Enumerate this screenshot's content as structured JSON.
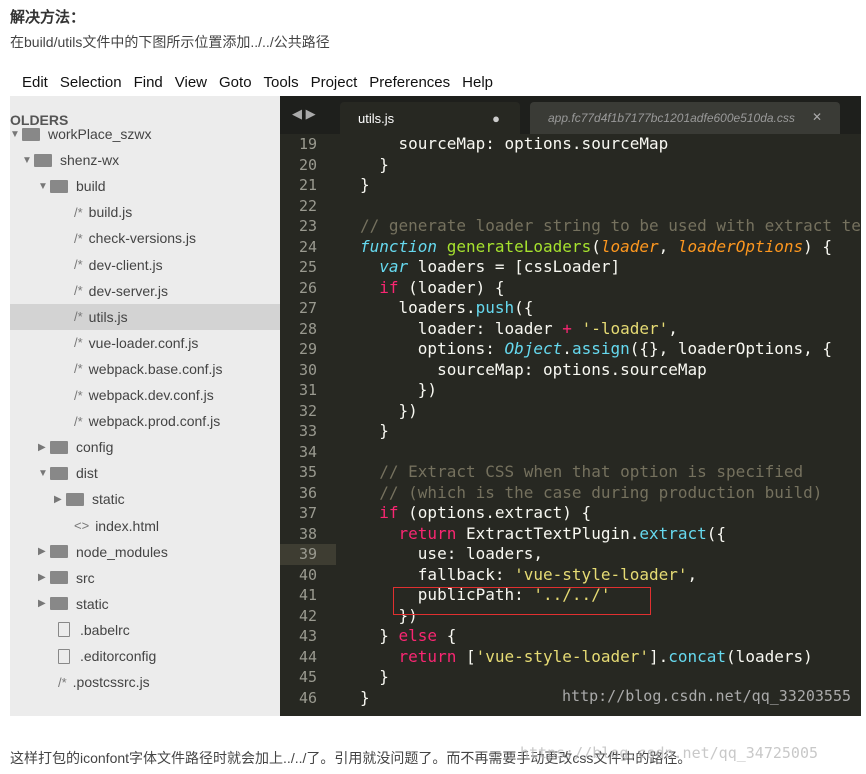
{
  "article": {
    "heading": "解决方法：",
    "intro": "在build/utils文件中的下图所示位置添加../../公共路径",
    "conclusion": "这样打包的iconfont字体文件路径时就会加上../../了。引用就没问题了。而不再需要手动更改css文件中的路径。",
    "watermark_bottom": "https://blog.csdn.net/qq_34725005"
  },
  "menu": [
    "Edit",
    "Selection",
    "Find",
    "View",
    "Goto",
    "Tools",
    "Project",
    "Preferences",
    "Help"
  ],
  "sidebar": {
    "title": "OLDERS",
    "items": [
      {
        "label": "workPlace_szwx",
        "type": "folder-open",
        "depth": 0
      },
      {
        "label": "shenz-wx",
        "type": "folder-open",
        "depth": 1
      },
      {
        "label": "build",
        "type": "folder-open",
        "depth": 2
      },
      {
        "label": "build.js",
        "type": "js",
        "depth": 3
      },
      {
        "label": "check-versions.js",
        "type": "js",
        "depth": 3
      },
      {
        "label": "dev-client.js",
        "type": "js",
        "depth": 3
      },
      {
        "label": "dev-server.js",
        "type": "js",
        "depth": 3
      },
      {
        "label": "utils.js",
        "type": "js",
        "depth": 3,
        "selected": true
      },
      {
        "label": "vue-loader.conf.js",
        "type": "js",
        "depth": 3
      },
      {
        "label": "webpack.base.conf.js",
        "type": "js",
        "depth": 3
      },
      {
        "label": "webpack.dev.conf.js",
        "type": "js",
        "depth": 3
      },
      {
        "label": "webpack.prod.conf.js",
        "type": "js",
        "depth": 3
      },
      {
        "label": "config",
        "type": "folder",
        "depth": 2
      },
      {
        "label": "dist",
        "type": "folder-open",
        "depth": 2
      },
      {
        "label": "static",
        "type": "folder",
        "depth": 3
      },
      {
        "label": "index.html",
        "type": "html",
        "depth": 3
      },
      {
        "label": "node_modules",
        "type": "folder",
        "depth": 2
      },
      {
        "label": "src",
        "type": "folder",
        "depth": 2
      },
      {
        "label": "static",
        "type": "folder",
        "depth": 2
      },
      {
        "label": ".babelrc",
        "type": "file",
        "depth": 2
      },
      {
        "label": ".editorconfig",
        "type": "file",
        "depth": 2
      },
      {
        "label": ".postcssrc.js",
        "type": "js",
        "depth": 2
      }
    ]
  },
  "editor": {
    "tabs": [
      {
        "label": "utils.js",
        "active": true,
        "modified": true
      },
      {
        "label": "app.fc77d4f1b7177bc1201adfe600e510da.css",
        "active": false
      }
    ],
    "current_line": 39,
    "watermark": "http://blog.csdn.net/qq_33203555",
    "lines": [
      {
        "n": 19,
        "t": [
          [
            "n",
            "    sourceMap: options.sourceMap"
          ]
        ]
      },
      {
        "n": 20,
        "t": [
          [
            "n",
            "  }"
          ]
        ]
      },
      {
        "n": 21,
        "t": [
          [
            "n",
            "}"
          ]
        ]
      },
      {
        "n": 22,
        "t": []
      },
      {
        "n": 23,
        "t": [
          [
            "c",
            "// generate loader string to be used with extract te"
          ]
        ]
      },
      {
        "n": 24,
        "t": [
          [
            "t",
            "function"
          ],
          [
            "n",
            " "
          ],
          [
            "f",
            "generateLoaders"
          ],
          [
            "n",
            "("
          ],
          [
            "a",
            "loader"
          ],
          [
            "n",
            ", "
          ],
          [
            "a",
            "loaderOptions"
          ],
          [
            "n",
            ") {"
          ]
        ]
      },
      {
        "n": 25,
        "t": [
          [
            "n",
            "  "
          ],
          [
            "t",
            "var"
          ],
          [
            "n",
            " loaders = [cssLoader]"
          ]
        ]
      },
      {
        "n": 26,
        "t": [
          [
            "n",
            "  "
          ],
          [
            "k",
            "if"
          ],
          [
            "n",
            " (loader) {"
          ]
        ]
      },
      {
        "n": 27,
        "t": [
          [
            "n",
            "    loaders."
          ],
          [
            "m",
            "push"
          ],
          [
            "n",
            "({"
          ]
        ]
      },
      {
        "n": 28,
        "t": [
          [
            "n",
            "      loader: loader "
          ],
          [
            "k",
            "+"
          ],
          [
            "n",
            " "
          ],
          [
            "s",
            "'-loader'"
          ],
          [
            "n",
            ","
          ]
        ]
      },
      {
        "n": 29,
        "t": [
          [
            "n",
            "      options: "
          ],
          [
            "t",
            "Object"
          ],
          [
            "n",
            "."
          ],
          [
            "m",
            "assign"
          ],
          [
            "n",
            "({}, loaderOptions, {"
          ]
        ]
      },
      {
        "n": 30,
        "t": [
          [
            "n",
            "        sourceMap: options.sourceMap"
          ]
        ]
      },
      {
        "n": 31,
        "t": [
          [
            "n",
            "      })"
          ]
        ]
      },
      {
        "n": 32,
        "t": [
          [
            "n",
            "    })"
          ]
        ]
      },
      {
        "n": 33,
        "t": [
          [
            "n",
            "  }"
          ]
        ]
      },
      {
        "n": 34,
        "t": []
      },
      {
        "n": 35,
        "t": [
          [
            "c",
            "  // Extract CSS when that option is specified"
          ]
        ]
      },
      {
        "n": 36,
        "t": [
          [
            "c",
            "  // (which is the case during production build)"
          ]
        ]
      },
      {
        "n": 37,
        "t": [
          [
            "n",
            "  "
          ],
          [
            "k",
            "if"
          ],
          [
            "n",
            " (options.extract) {"
          ]
        ]
      },
      {
        "n": 38,
        "t": [
          [
            "n",
            "    "
          ],
          [
            "k",
            "return"
          ],
          [
            "n",
            " ExtractTextPlugin."
          ],
          [
            "m",
            "extract"
          ],
          [
            "n",
            "({"
          ]
        ]
      },
      {
        "n": 39,
        "t": [
          [
            "n",
            "      use: loaders,"
          ]
        ]
      },
      {
        "n": 40,
        "t": [
          [
            "n",
            "      fallback: "
          ],
          [
            "s",
            "'vue-style-loader'"
          ],
          [
            "n",
            ","
          ]
        ]
      },
      {
        "n": 41,
        "t": [
          [
            "n",
            "      publicPath: "
          ],
          [
            "s",
            "'../../'"
          ]
        ]
      },
      {
        "n": 42,
        "t": [
          [
            "n",
            "    })"
          ]
        ]
      },
      {
        "n": 43,
        "t": [
          [
            "n",
            "  } "
          ],
          [
            "k",
            "else"
          ],
          [
            "n",
            " {"
          ]
        ]
      },
      {
        "n": 44,
        "t": [
          [
            "n",
            "    "
          ],
          [
            "k",
            "return"
          ],
          [
            "n",
            " ["
          ],
          [
            "s",
            "'vue-style-loader'"
          ],
          [
            "n",
            "]."
          ],
          [
            "m",
            "concat"
          ],
          [
            "n",
            "(loaders)"
          ]
        ]
      },
      {
        "n": 45,
        "t": [
          [
            "n",
            "  }"
          ]
        ]
      },
      {
        "n": 46,
        "t": [
          [
            "n",
            "}"
          ]
        ]
      }
    ]
  }
}
